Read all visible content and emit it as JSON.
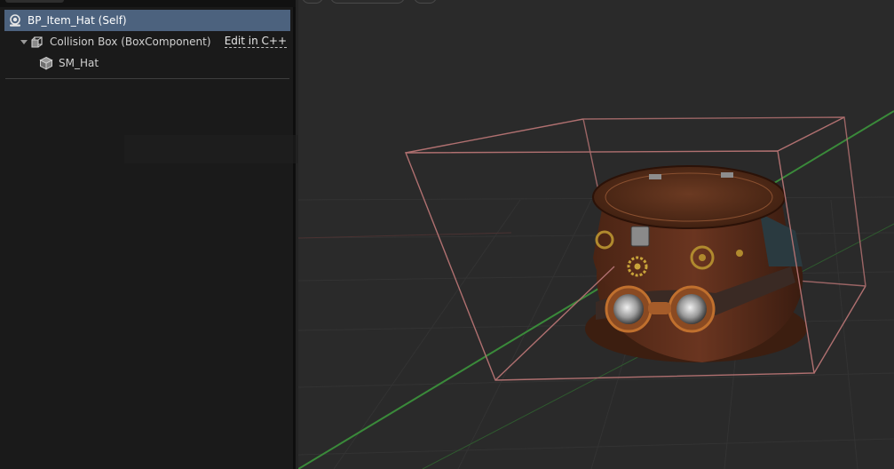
{
  "components": {
    "root": {
      "label": "BP_Item_Hat (Self)",
      "icon": "blueprint-actor-icon"
    },
    "items": [
      {
        "label": "Collision Box (BoxComponent)",
        "icon": "box-collision-icon",
        "action": "Edit in C++",
        "expanded": true
      },
      {
        "label": "SM_Hat",
        "icon": "static-mesh-icon"
      }
    ]
  },
  "viewport": {
    "subject": "steampunk-top-hat-with-goggles",
    "colors": {
      "background": "#2a2a2a",
      "grid": "#333333",
      "x_axis": "#3a8a3a",
      "bounds": "#b07070",
      "hat_brown": "#5a2e1a",
      "brass": "#b08a2e"
    }
  }
}
